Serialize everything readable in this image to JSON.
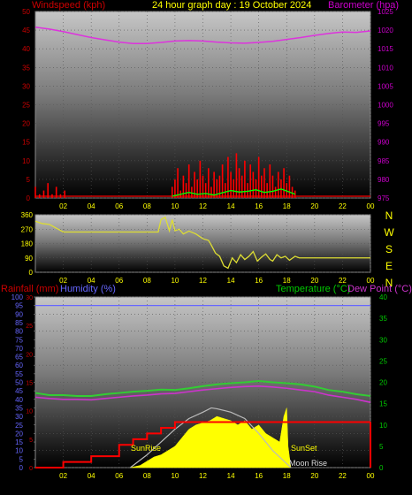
{
  "header": {
    "left": "Windspeed (kph)",
    "center": "24 hour graph day : 19 October 2024",
    "right": "Barometer (hpa)"
  },
  "colors": {
    "wind_axis": "#cc0000",
    "baro_axis": "#cc00cc",
    "title": "#ffff00",
    "rain_axis": "#cc0000",
    "humidity_axis": "#6666ff",
    "temp_axis": "#00cc00",
    "wind_series": "#ff0000",
    "gust_series": "#00ff00",
    "baro_series": "#dd33dd",
    "dir_series": "#dddd33",
    "sun_area": "#ffff00",
    "sun_arc": "#bbbbbb",
    "rain_series": "#ff0000",
    "humidity_series": "#6666ff",
    "temp_series": "#33cc33",
    "dew_series": "#cc33cc",
    "grid": "#555555"
  },
  "chart_data": [
    {
      "type": "line",
      "panel": "wind-baro",
      "x_ticks": [
        "02",
        "04",
        "06",
        "08",
        "10",
        "12",
        "14",
        "16",
        "18",
        "20",
        "22",
        "00"
      ],
      "y_left_ticks": [
        "0",
        "5",
        "10",
        "15",
        "20",
        "25",
        "30",
        "35",
        "40",
        "45",
        "50"
      ],
      "y_right_ticks": [
        "975",
        "980",
        "985",
        "990",
        "995",
        "1000",
        "1005",
        "1010",
        "1015",
        "1020",
        "1025"
      ],
      "ylim_left": [
        0,
        50
      ],
      "ylim_right": [
        975,
        1025
      ],
      "series": [
        {
          "name": "Barometer",
          "axis": "right",
          "x": [
            0,
            1,
            2,
            3,
            4,
            5,
            6,
            7,
            8,
            9,
            10,
            11,
            12,
            13,
            14,
            15,
            16,
            17,
            18,
            19,
            20,
            21,
            22,
            23,
            24
          ],
          "values": [
            1020.8,
            1020.3,
            1019.6,
            1018.8,
            1018.0,
            1017.4,
            1016.8,
            1016.4,
            1016.4,
            1016.7,
            1017.1,
            1017.2,
            1017.1,
            1016.8,
            1016.6,
            1016.5,
            1016.7,
            1017.0,
            1017.5,
            1018.0,
            1018.6,
            1019.1,
            1019.5,
            1019.4,
            1019.8
          ]
        },
        {
          "axis": "left",
          "x": [
            0.0,
            0.3,
            0.6,
            0.9,
            1.2,
            1.5,
            1.8,
            2.1,
            9.8,
            10.0,
            10.2,
            10.4,
            10.6,
            10.8,
            11.0,
            11.2,
            11.4,
            11.6,
            11.8,
            12.0,
            12.2,
            12.4,
            12.6,
            12.8,
            13.0,
            13.2,
            13.4,
            13.6,
            13.8,
            14.0,
            14.2,
            14.4,
            14.6,
            14.8,
            15.0,
            15.2,
            15.4,
            15.6,
            15.8,
            16.0,
            16.2,
            16.4,
            16.6,
            16.8,
            17.0,
            17.2,
            17.4,
            17.6,
            17.8,
            18.0,
            18.2,
            18.4,
            18.6
          ],
          "values": [
            3,
            1,
            2,
            4,
            1,
            3,
            1,
            2,
            3,
            5,
            8,
            2,
            6,
            4,
            9,
            3,
            7,
            5,
            10,
            6,
            4,
            8,
            3,
            7,
            5,
            6,
            9,
            4,
            11,
            7,
            5,
            12,
            8,
            6,
            10,
            4,
            9,
            7,
            5,
            11,
            6,
            8,
            4,
            9,
            6,
            3,
            7,
            5,
            8,
            4,
            6,
            3,
            2
          ]
        },
        {
          "axis": "left",
          "x": [
            9.8,
            10.4,
            11.0,
            11.6,
            12.2,
            12.8,
            13.4,
            14.0,
            14.6,
            15.2,
            15.8,
            16.4,
            17.0,
            17.6,
            18.2,
            18.6
          ],
          "values": [
            0.5,
            1.0,
            1.5,
            1.0,
            1.2,
            0.8,
            1.4,
            2.0,
            1.6,
            1.8,
            2.2,
            1.5,
            1.8,
            2.4,
            1.6,
            1.0
          ]
        }
      ]
    },
    {
      "type": "line",
      "panel": "wind-direction",
      "x_ticks": [
        "02",
        "04",
        "06",
        "08",
        "10",
        "12",
        "14",
        "16",
        "18",
        "20",
        "22",
        "00"
      ],
      "y_ticks": [
        "0",
        "90",
        "180",
        "270",
        "360"
      ],
      "ylim": [
        0,
        360
      ],
      "compass": [
        "N",
        "W",
        "S",
        "E",
        "N"
      ],
      "series": [
        {
          "x": [
            0,
            0.5,
            1.0,
            2.0,
            4.0,
            6.0,
            8.0,
            8.8,
            9.0,
            9.3,
            9.6,
            9.8,
            10.0,
            10.3,
            10.6,
            11.0,
            11.5,
            12.0,
            12.4,
            12.6,
            12.9,
            13.2,
            13.5,
            13.8,
            14.1,
            14.4,
            14.7,
            15.0,
            15.3,
            15.6,
            15.9,
            16.2,
            16.5,
            16.8,
            17.0,
            17.3,
            17.6,
            17.9,
            18.2,
            18.6,
            18.9,
            24
          ],
          "values": [
            320,
            305,
            300,
            252,
            252,
            252,
            252,
            252,
            330,
            345,
            260,
            330,
            260,
            270,
            240,
            258,
            240,
            210,
            200,
            170,
            120,
            100,
            40,
            25,
            90,
            60,
            110,
            80,
            100,
            130,
            70,
            95,
            115,
            80,
            70,
            110,
            90,
            100,
            75,
            100,
            90,
            90
          ]
        }
      ]
    },
    {
      "type": "line",
      "panel": "rain-humidity-temp",
      "x_ticks": [
        "02",
        "04",
        "06",
        "08",
        "10",
        "12",
        "14",
        "16",
        "18",
        "20",
        "22",
        "00"
      ],
      "y_left_ticks": [
        "0",
        "5",
        "10",
        "15",
        "20",
        "25",
        "30",
        "35",
        "40",
        "45",
        "50",
        "55",
        "60",
        "65",
        "70",
        "75",
        "80",
        "85",
        "90",
        "95",
        "100"
      ],
      "y_right_ticks": [
        "0",
        "5",
        "10",
        "15",
        "20",
        "25",
        "30",
        "35",
        "40"
      ],
      "ylim_left": [
        0,
        100
      ],
      "ylim_right": [
        0,
        40
      ],
      "series": [
        {
          "name": "Humidity",
          "axis": "left",
          "x": [
            0,
            24
          ],
          "values": [
            95,
            95
          ]
        },
        {
          "name": "Rainfall",
          "axis": "left",
          "x": [
            0,
            2,
            4,
            6,
            7,
            8,
            9,
            10,
            12,
            14,
            16,
            18,
            20,
            22,
            24
          ],
          "values": [
            0,
            1,
            2,
            4,
            5,
            6,
            7,
            8,
            8,
            8,
            8,
            8,
            8,
            8,
            8
          ]
        },
        {
          "name": "Temperature",
          "axis": "right",
          "x": [
            0,
            1,
            2,
            3,
            4,
            5,
            6,
            7,
            8,
            9,
            10,
            11,
            12,
            13,
            14,
            15,
            16,
            17,
            18,
            19,
            20,
            21,
            22,
            23,
            24
          ],
          "values": [
            17.5,
            17.0,
            17.0,
            16.8,
            16.8,
            17.2,
            17.5,
            17.8,
            18.0,
            18.3,
            18.2,
            18.6,
            19.1,
            19.5,
            19.8,
            20.0,
            20.3,
            20.0,
            19.8,
            19.5,
            19.0,
            18.2,
            17.8,
            17.2,
            16.8
          ]
        },
        {
          "name": "Dew Point",
          "axis": "right",
          "x": [
            0,
            1,
            2,
            3,
            4,
            5,
            6,
            7,
            8,
            9,
            10,
            11,
            12,
            13,
            14,
            15,
            16,
            17,
            18,
            19,
            20,
            21,
            22,
            23,
            24
          ],
          "values": [
            16.5,
            16.2,
            16.0,
            16.0,
            15.9,
            16.2,
            16.5,
            16.8,
            17.0,
            17.3,
            17.4,
            17.8,
            18.2,
            18.5,
            18.8,
            19.0,
            19.1,
            18.9,
            18.6,
            18.2,
            17.8,
            17.0,
            16.5,
            16.0,
            15.3
          ]
        },
        {
          "axis": "right",
          "x": [
            6.8,
            7.5,
            8.0,
            8.5,
            9.0,
            9.5,
            10.0,
            10.5,
            11.0,
            11.5,
            12.0,
            12.5,
            13.0,
            13.5,
            14.0,
            14.5,
            15.0,
            15.5,
            16.0,
            16.5,
            17.0,
            17.5,
            17.8,
            18.0,
            18.1,
            18.3
          ],
          "values": [
            0,
            0.5,
            1.5,
            2.5,
            3,
            4,
            5,
            7,
            9,
            10,
            10.5,
            11,
            12,
            11.5,
            11,
            10,
            11,
            9,
            10,
            8,
            7,
            6,
            12,
            14,
            5,
            0
          ]
        },
        {
          "axis": "right",
          "x": [
            6.8,
            8.0,
            9.0,
            10.0,
            11.0,
            12.0,
            12.6,
            13.0,
            14.0,
            15.0,
            16.0,
            17.0,
            18.3
          ],
          "values": [
            0,
            3,
            6,
            9,
            11.5,
            13,
            14,
            13.8,
            13,
            11.5,
            8,
            4,
            0
          ]
        }
      ],
      "annotations": [
        "SunRise",
        "SunSet",
        "Moon Rise"
      ]
    }
  ],
  "bottom_header": {
    "rain": "Rainfall (mm)",
    "humidity": "Humidity (%)",
    "temperature": "Temperature (°C)",
    "dewpoint": "Dew Point (°C)"
  }
}
